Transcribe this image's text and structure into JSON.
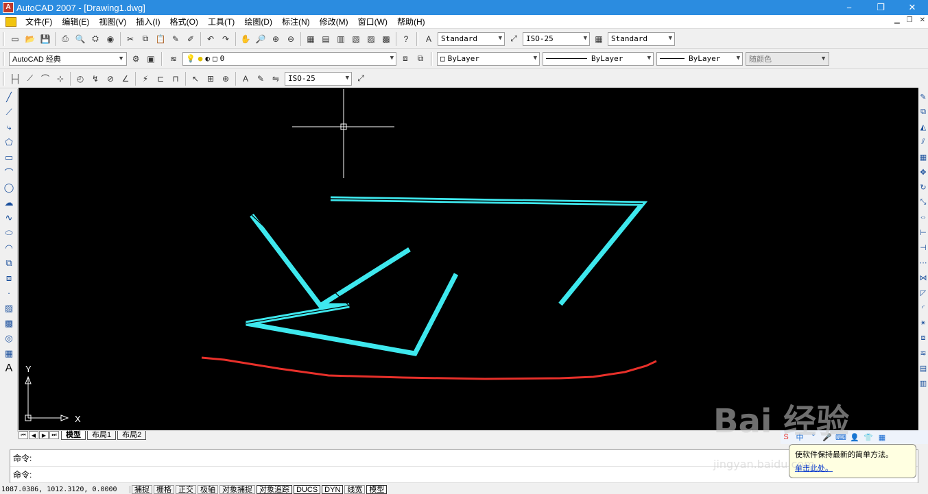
{
  "window": {
    "title": "AutoCAD 2007 - [Drawing1.dwg]",
    "min": "−",
    "max": "❐",
    "close": "✕"
  },
  "menu": [
    "文件(F)",
    "编辑(E)",
    "视图(V)",
    "插入(I)",
    "格式(O)",
    "工具(T)",
    "绘图(D)",
    "标注(N)",
    "修改(M)",
    "窗口(W)",
    "帮助(H)"
  ],
  "styles": {
    "text_style": "Standard",
    "dim_style": "ISO-25",
    "table_style": "Standard"
  },
  "layers": {
    "workspace": "AutoCAD 经典",
    "current_layer": "0",
    "color": "ByLayer",
    "linetype": "ByLayer",
    "lineweight": "ByLayer",
    "plot_style": "随颜色"
  },
  "dimension": {
    "dim_style": "ISO-25"
  },
  "ucs": {
    "x_label": "X",
    "y_label": "Y"
  },
  "tabs": {
    "model": "模型",
    "layout1": "布局1",
    "layout2": "布局2"
  },
  "command": {
    "line1": "命令:",
    "line2": "命令:"
  },
  "status": {
    "coords": "1087.0386, 1012.3120, 0.0000",
    "buttons": [
      "捕捉",
      "栅格",
      "正交",
      "极轴",
      "对象捕捉",
      "对象追踪",
      "DUCS",
      "DYN",
      "线宽",
      "模型"
    ]
  },
  "balloon": {
    "text": "使软件保持最新的简单方法。",
    "link": "单击此处。"
  },
  "watermark": {
    "logo": "Bai 经验",
    "url": "jingyan.baidu.com"
  },
  "colors": {
    "accent": "#2b8ce0",
    "cyan_lines": "#3ee8ee",
    "red_line": "#e8302a"
  }
}
